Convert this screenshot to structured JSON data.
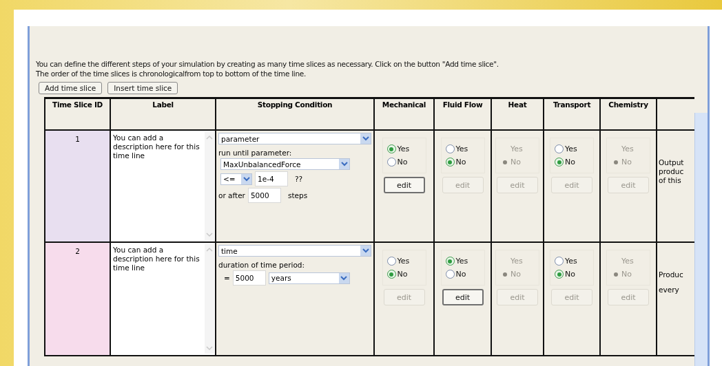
{
  "intro": {
    "lines": [
      "You can define the different steps of your simulation by creating as many time slices as necessary. Click on the button \"Add time slice\".",
      "The order of the time slices is chronologicalfrom top to bottom of the time line."
    ]
  },
  "toolbar": {
    "buttons": [
      "Add time slice",
      "Insert time slice"
    ]
  },
  "table": {
    "columns": [
      "Time Slice ID",
      "Label",
      "Stopping Condition",
      "Mechanical",
      "Fluid Flow",
      "Heat",
      "Transport",
      "Chemistry"
    ],
    "rows": [
      {
        "id": "1",
        "color": "#e8dff0",
        "label": "You can add a description here for this time line",
        "condition": {
          "kind": "parameter",
          "type": "parameter",
          "caption": "run until parameter:",
          "parameter": "MaxUnbalancedForce",
          "operator": "<=",
          "threshold": "1e-4",
          "unit": "??",
          "after_label": "or after",
          "steps": "5000",
          "steps_label": "steps"
        },
        "modules": [
          {
            "disabled": false,
            "options": [
              {
                "label": "Yes",
                "selected": true
              },
              {
                "label": "No",
                "selected": false
              }
            ],
            "edit": {
              "label": "edit",
              "disabled": false
            }
          },
          {
            "disabled": false,
            "options": [
              {
                "label": "Yes",
                "selected": false
              },
              {
                "label": "No",
                "selected": true
              }
            ],
            "edit": {
              "label": "edit",
              "disabled": true
            }
          },
          {
            "disabled": true,
            "options": [
              {
                "label": "Yes",
                "selected": false
              },
              {
                "label": "No",
                "selected": true
              }
            ],
            "edit": {
              "label": "edit",
              "disabled": true
            }
          },
          {
            "disabled": false,
            "options": [
              {
                "label": "Yes",
                "selected": false
              },
              {
                "label": "No",
                "selected": true
              }
            ],
            "edit": {
              "label": "edit",
              "disabled": true
            }
          },
          {
            "disabled": true,
            "options": [
              {
                "label": "Yes",
                "selected": false
              },
              {
                "label": "No",
                "selected": true
              }
            ],
            "edit": {
              "label": "edit",
              "disabled": true
            }
          }
        ],
        "output": [
          "Output",
          "produc",
          "of this"
        ]
      },
      {
        "id": "2",
        "color": "#f7dcec",
        "label": "You can add a description here for this time line",
        "condition": {
          "kind": "time",
          "type": "time",
          "caption": "duration of time period:",
          "operator": "=",
          "value": "5000",
          "unit": "years"
        },
        "modules": [
          {
            "disabled": false,
            "options": [
              {
                "label": "Yes",
                "selected": false
              },
              {
                "label": "No",
                "selected": true
              }
            ],
            "edit": {
              "label": "edit",
              "disabled": true
            }
          },
          {
            "disabled": false,
            "options": [
              {
                "label": "Yes",
                "selected": true
              },
              {
                "label": "No",
                "selected": false
              }
            ],
            "edit": {
              "label": "edit",
              "disabled": false
            }
          },
          {
            "disabled": true,
            "options": [
              {
                "label": "Yes",
                "selected": false
              },
              {
                "label": "No",
                "selected": true
              }
            ],
            "edit": {
              "label": "edit",
              "disabled": true
            }
          },
          {
            "disabled": false,
            "options": [
              {
                "label": "Yes",
                "selected": false
              },
              {
                "label": "No",
                "selected": true
              }
            ],
            "edit": {
              "label": "edit",
              "disabled": true
            }
          },
          {
            "disabled": true,
            "options": [
              {
                "label": "Yes",
                "selected": false
              },
              {
                "label": "No",
                "selected": true
              }
            ],
            "edit": {
              "label": "edit",
              "disabled": true
            }
          }
        ],
        "output": [
          "Produc",
          "every"
        ]
      }
    ]
  }
}
